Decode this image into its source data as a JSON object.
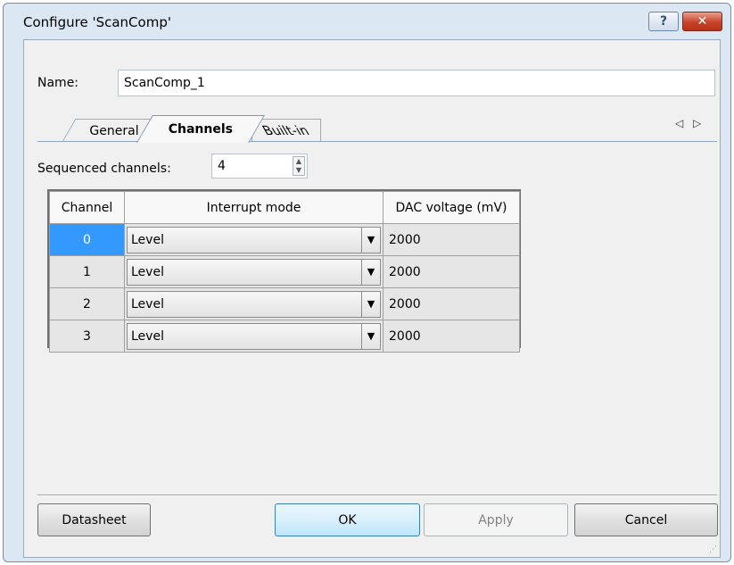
{
  "window": {
    "title": "Configure 'ScanComp'",
    "help_label": "?",
    "close_label": "✕"
  },
  "name": {
    "label": "Name:",
    "value": "ScanComp_1"
  },
  "tabs": [
    {
      "label": "General"
    },
    {
      "label": "Channels"
    },
    {
      "label": "Built-in"
    }
  ],
  "tab_nav": {
    "prev": "◁",
    "next": "▷"
  },
  "sequenced": {
    "label": "Sequenced channels:",
    "value": "4"
  },
  "grid": {
    "columns": [
      "Channel",
      "Interrupt mode",
      "DAC voltage (mV)"
    ],
    "rows": [
      {
        "channel": "0",
        "mode": "Level",
        "dac": "2000"
      },
      {
        "channel": "1",
        "mode": "Level",
        "dac": "2000"
      },
      {
        "channel": "2",
        "mode": "Level",
        "dac": "2000"
      },
      {
        "channel": "3",
        "mode": "Level",
        "dac": "2000"
      }
    ]
  },
  "buttons": {
    "datasheet": "Datasheet",
    "ok": "OK",
    "apply": "Apply",
    "cancel": "Cancel"
  }
}
